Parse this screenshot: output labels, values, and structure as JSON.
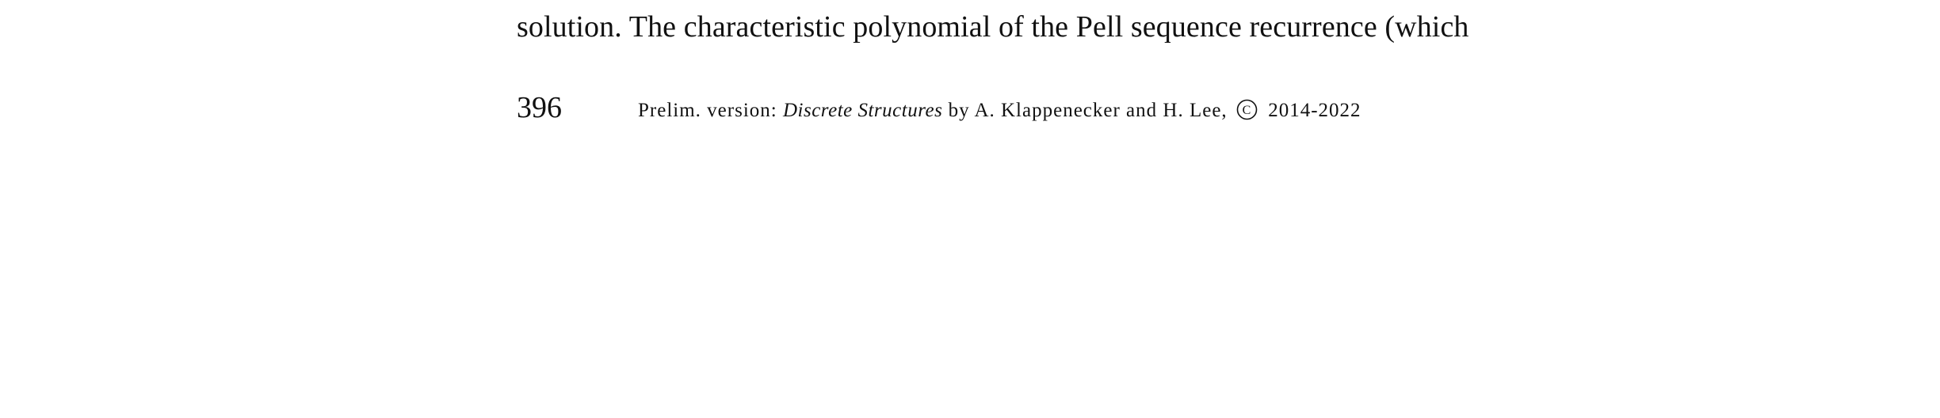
{
  "document": {
    "body_line": "solution.  The characteristic polynomial of the Pell sequence recurrence (which",
    "footer": {
      "page_number": "396",
      "prefix": "Prelim. version: ",
      "book_title": "Discrete Structures",
      "authors": " by A. Klappenecker and H. Lee, ",
      "copyright_icon": "copyright-icon",
      "years": " 2014-2022"
    }
  }
}
